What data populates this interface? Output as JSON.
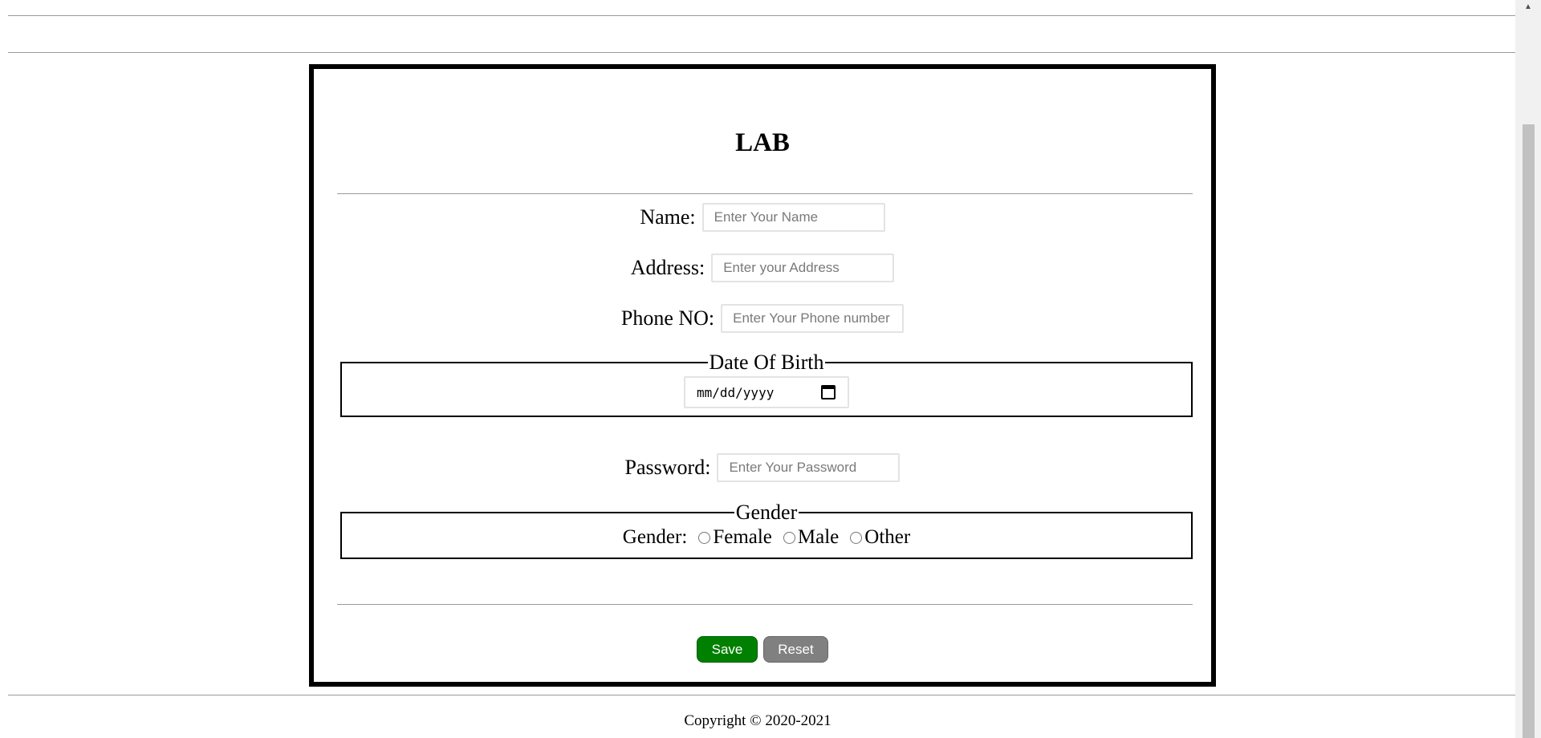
{
  "form": {
    "title": "LAB",
    "name": {
      "label": "Name:",
      "placeholder": "Enter Your Name"
    },
    "address": {
      "label": "Address:",
      "placeholder": "Enter your Address"
    },
    "phone": {
      "label": "Phone NO:",
      "placeholder": "Enter Your Phone number"
    },
    "dob": {
      "legend": "Date Of Birth",
      "value": "mm/dd/yyyy"
    },
    "password": {
      "label": "Password:",
      "placeholder": "Enter Your Password"
    },
    "gender": {
      "legend": "Gender",
      "label": "Gender:",
      "options": [
        "Female",
        "Male",
        "Other"
      ]
    },
    "buttons": {
      "save": "Save",
      "reset": "Reset"
    },
    "colors": {
      "save": "#008000",
      "reset": "#808080"
    }
  },
  "footer": {
    "copyright": "Copyright © 2020-2021"
  }
}
